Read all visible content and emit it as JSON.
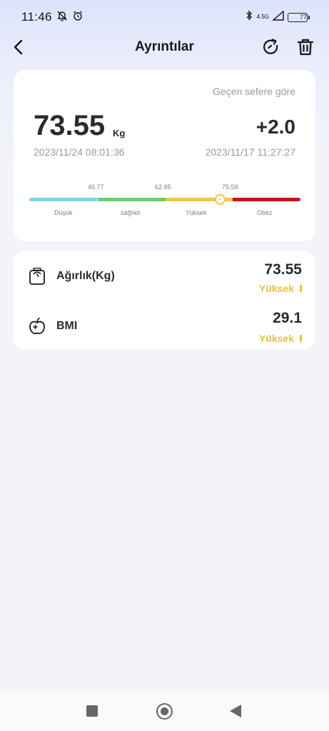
{
  "status_bar": {
    "time": "11:46",
    "network": "4.5G",
    "battery": "77"
  },
  "header": {
    "title": "Ayrıntılar"
  },
  "summary": {
    "compare_note": "Geçen sefere göre",
    "weight": "73.55",
    "unit": "Kg",
    "difference": "+2.0",
    "current_date": "2023/11/24 08:01:36",
    "previous_date": "2023/11/17 11:27:27",
    "thresholds": [
      "46.77",
      "62.95",
      "75.59"
    ],
    "ranges": [
      "Düşük",
      "sağlıklı",
      "Yüksek",
      "Obez"
    ],
    "range_colors": [
      "#7fcfee",
      "#6bcd6b",
      "#f0c74a",
      "#c8101a"
    ],
    "indicator_value": 73.55
  },
  "metrics": [
    {
      "label": "Ağırlık(Kg)",
      "value": "73.55",
      "status": "Yüksek",
      "icon": "scale-icon"
    },
    {
      "label": "BMI",
      "value": "29.1",
      "status": "Yüksek",
      "icon": "apple-icon"
    }
  ],
  "nav": {
    "icons": [
      "recent-apps-icon",
      "home-icon",
      "back-icon"
    ]
  }
}
